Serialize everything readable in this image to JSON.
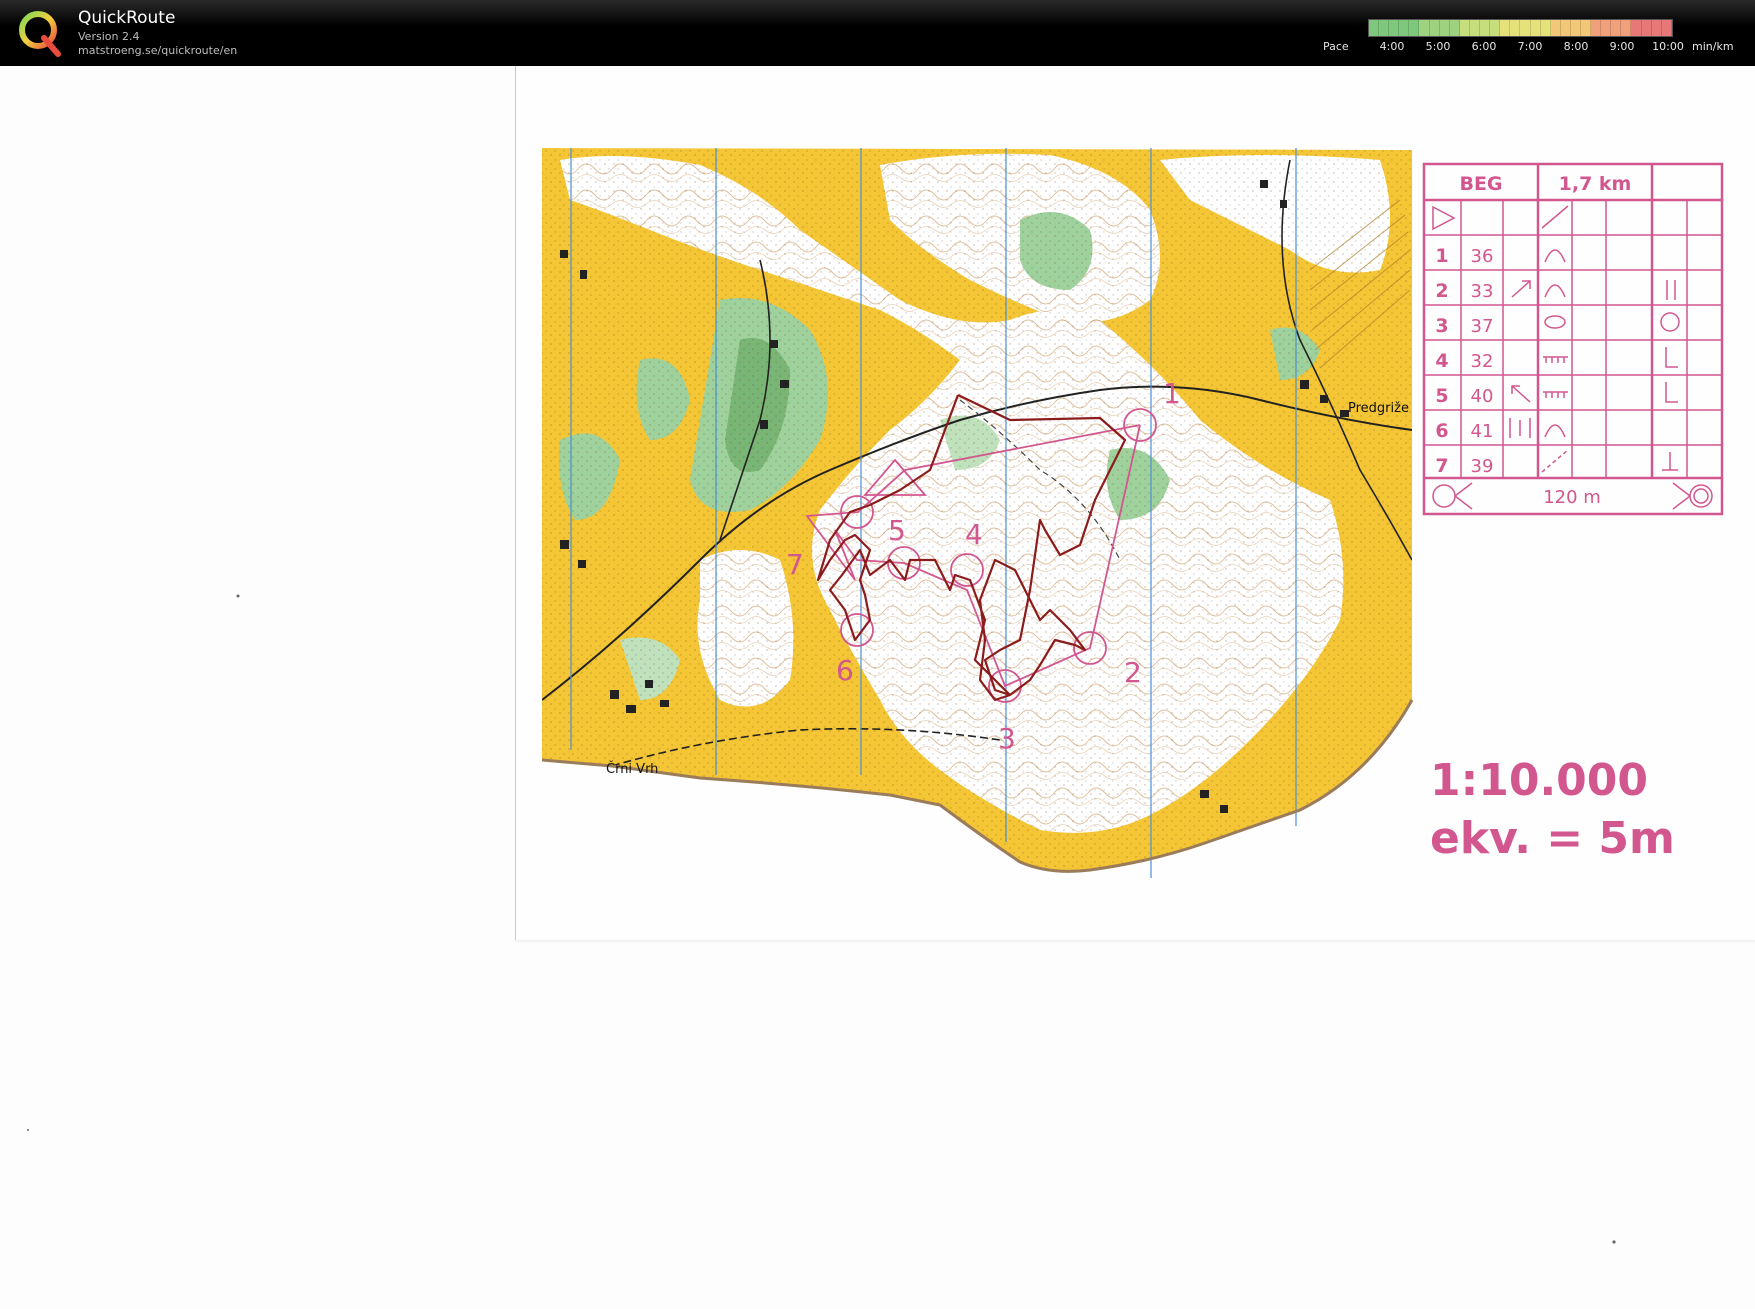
{
  "app": {
    "title": "QuickRoute",
    "version": "Version 2.4",
    "url": "matstroeng.se/quickroute/en"
  },
  "pace_legend": {
    "label": "Pace",
    "ticks": [
      "4:00",
      "5:00",
      "6:00",
      "7:00",
      "8:00",
      "9:00",
      "10:00"
    ],
    "unit": "min/km",
    "gradient_colors": [
      "#7ec87e",
      "#9fd27f",
      "#c7de7c",
      "#e5e27a",
      "#f2c777",
      "#f0a07a",
      "#e87878"
    ]
  },
  "map": {
    "place_labels": [
      "Predgriže",
      "Črni Vrh"
    ],
    "scale": "1:10.000",
    "contour": "ekv. = 5m",
    "controls": [
      "1",
      "2",
      "3",
      "4",
      "5",
      "6",
      "7"
    ],
    "colors": {
      "open_land": "#f4c534",
      "forest": "#ffffff",
      "green": "#9fd19c",
      "course": "#d2578f",
      "route": "#8c1c1c",
      "contour": "#c58a4a",
      "north_lines": "#4a8fd6"
    }
  },
  "control_description": {
    "event": "BEG",
    "length": "1,7 km",
    "rows": [
      {
        "num": "1",
        "code": "36"
      },
      {
        "num": "2",
        "code": "33"
      },
      {
        "num": "3",
        "code": "37"
      },
      {
        "num": "4",
        "code": "32"
      },
      {
        "num": "5",
        "code": "40"
      },
      {
        "num": "6",
        "code": "41"
      },
      {
        "num": "7",
        "code": "39"
      }
    ],
    "finish_distance": "120 m"
  }
}
